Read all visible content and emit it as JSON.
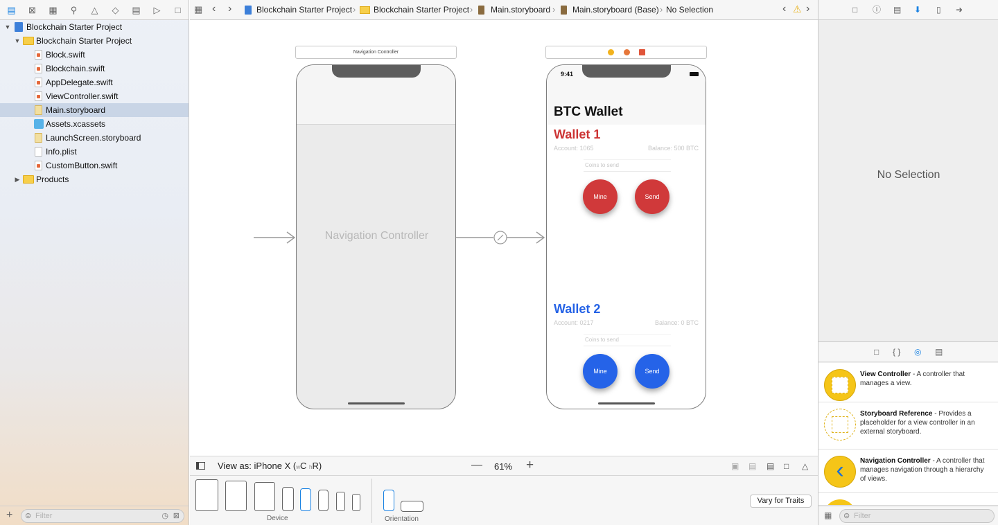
{
  "navigator": {
    "tree": [
      {
        "label": "Blockchain Starter Project",
        "kind": "project"
      },
      {
        "label": "Blockchain Starter Project",
        "kind": "folder"
      },
      {
        "label": "Block.swift",
        "kind": "swift"
      },
      {
        "label": "Blockchain.swift",
        "kind": "swift"
      },
      {
        "label": "AppDelegate.swift",
        "kind": "swift"
      },
      {
        "label": "ViewController.swift",
        "kind": "swift"
      },
      {
        "label": "Main.storyboard",
        "kind": "storyboard",
        "selected": true
      },
      {
        "label": "Assets.xcassets",
        "kind": "assets"
      },
      {
        "label": "LaunchScreen.storyboard",
        "kind": "storyboard"
      },
      {
        "label": "Info.plist",
        "kind": "plist"
      },
      {
        "label": "CustomButton.swift",
        "kind": "swift"
      },
      {
        "label": "Products",
        "kind": "folder"
      }
    ],
    "filter_placeholder": "Filter"
  },
  "jumpbar": {
    "crumbs": [
      "Blockchain Starter Project",
      "Blockchain Starter Project",
      "Main.storyboard",
      "Main.storyboard (Base)",
      "No Selection"
    ]
  },
  "canvas": {
    "nav_scene_title": "Navigation Controller",
    "nav_scene_label": "Navigation Controller",
    "phone": {
      "time": "9:41",
      "title": "BTC Wallet",
      "wallets": [
        {
          "name": "Wallet 1",
          "account": "Account: 1065",
          "balance": "Balance: 500 BTC",
          "placeholder": "Coins to send",
          "mine": "Mine",
          "send": "Send",
          "color": "#cc3333"
        },
        {
          "name": "Wallet 2",
          "account": "Account: 0217",
          "balance": "Balance: 0 BTC",
          "placeholder": "Coins to send",
          "mine": "Mine",
          "send": "Send",
          "color": "#2462e6"
        }
      ]
    }
  },
  "bottombar": {
    "view_as": "View as: iPhone X (",
    "size_w": "w",
    "size_c": "C",
    "size_h": "h",
    "size_r": "R)",
    "zoom": "61%",
    "device_label": "Device",
    "orientation_label": "Orientation",
    "vary_button": "Vary for Traits"
  },
  "inspector": {
    "empty_text": "No Selection",
    "library": [
      {
        "title": "View Controller",
        "desc": " - A controller that manages a view."
      },
      {
        "title": "Storyboard Reference",
        "desc": " - Provides a placeholder for a view controller in an external storyboard."
      },
      {
        "title": "Navigation Controller",
        "desc": " - A controller that manages navigation through a hierarchy of views."
      }
    ],
    "filter_placeholder": "Filter"
  },
  "colors": {
    "accent": "#1a82e2",
    "wallet1": "#cc3333",
    "wallet2": "#2462e6",
    "library_yellow": "#f5c518"
  }
}
